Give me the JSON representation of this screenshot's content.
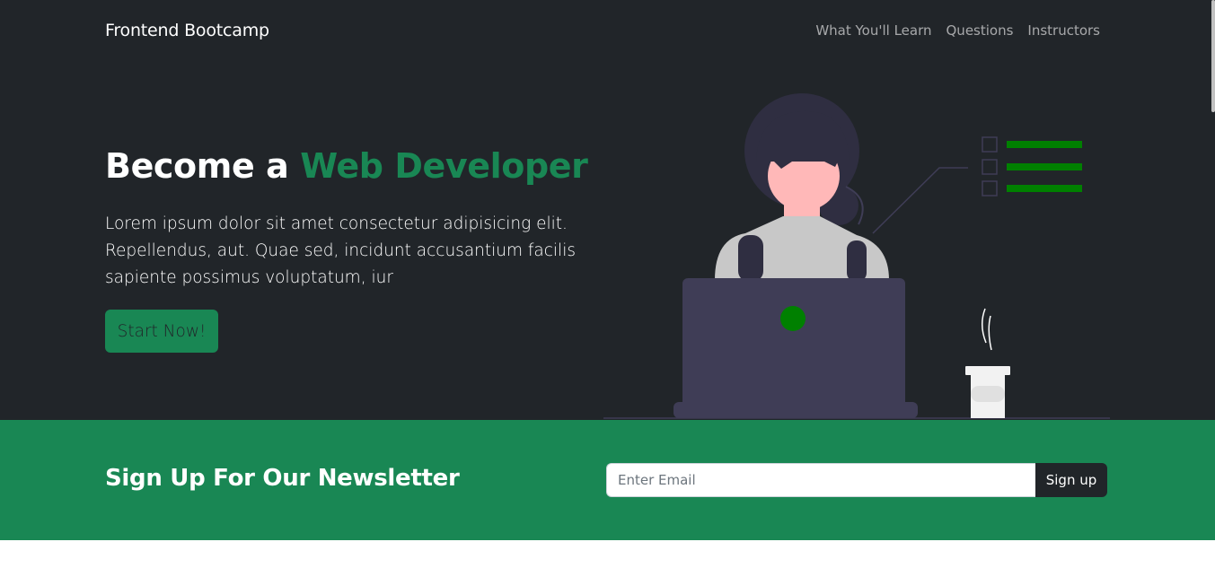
{
  "navbar": {
    "brand": "Frontend Bootcamp",
    "links": [
      {
        "label": "What You'll Learn"
      },
      {
        "label": "Questions"
      },
      {
        "label": "Instructors"
      }
    ]
  },
  "hero": {
    "title_prefix": "Become a ",
    "title_accent": "Web Developer",
    "lead": "Lorem ipsum dolor sit amet consectetur adipisicing elit. Repellendus, aut. Quae sed, incidunt accusantium facilis sapiente possimus voluptatum, iur",
    "cta_label": "Start Now!"
  },
  "newsletter": {
    "title": "Sign Up For Our Newsletter",
    "email_placeholder": "Enter Email",
    "email_value": "",
    "button_label": "Sign up"
  },
  "colors": {
    "dark_bg": "#212529",
    "accent_green": "#198754",
    "illustration_green": "#008000",
    "laptop": "#3f3d56",
    "skin": "#ffb8b8",
    "hair": "#2f2e41"
  },
  "illustration": {
    "icon": "woman-at-laptop-illustration",
    "checklist_items": 3
  }
}
